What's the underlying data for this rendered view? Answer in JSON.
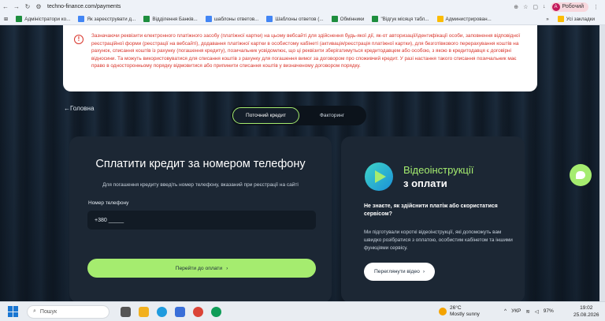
{
  "browser": {
    "url": "techno-finance.com/payments",
    "profile_label": "Робочий",
    "profile_initial": "А",
    "bookmarks": [
      {
        "label": "Адміністратори ко...",
        "color": "#1e8e3e"
      },
      {
        "label": "Як зареєструвати д...",
        "color": "#4285f4"
      },
      {
        "label": "Відділення Банків...",
        "color": "#1e8e3e"
      },
      {
        "label": "шаблоны ответов...",
        "color": "#4285f4"
      },
      {
        "label": "Шаблоны ответов (...",
        "color": "#4285f4"
      },
      {
        "label": "Обмінники",
        "color": "#1e8e3e"
      },
      {
        "label": "\"Відгук місяця табл...",
        "color": "#1e8e3e"
      },
      {
        "label": "Администрирован...",
        "color": "#fbbc04"
      }
    ],
    "all_bookmarks_label": "Усі закладки",
    "more_label": "»"
  },
  "warning": {
    "text": "Зазначаючи реквізити електронного платіжного засобу (платіжної картки) на цьому вебсайті для здійснення будь-якої дії, як-от авторизації/ідентифікації особи, заповнення відповідної реєстраційної форми (реєстрації на вебсайті), додавання платіжної картки в особистому кабінеті (активація/реєстрація платіжної картки), для безготівкового перерахування коштів на рахунок, списання коштів із рахунку (погашення кредиту), позичальник усвідомлює, що ці реквізити зберігатимуться кредитодавцем або особою, з якою в кредитодавця є договірні відносини. Та можуть використовуватися для списання коштів з рахунку для погашення вимог за договором про споживчий кредит. У разі настання такого списання позичальник має право в односторонньому порядку відмовитися або припинити списання коштів у визначеному договором порядку."
  },
  "nav": {
    "back_label": "Головна"
  },
  "tabs": [
    {
      "label": "Поточний кредит",
      "active": true
    },
    {
      "label": "Факторинг",
      "active": false
    }
  ],
  "pay_form": {
    "title": "Сплатити кредит за номером телефону",
    "hint": "Для погашення кредиту введіть номер телефону, вказаний при реєстрації на сайті",
    "phone_label": "Номер телефону",
    "phone_value": "+380 _____",
    "submit_label": "Перейти до оплати",
    "submit_arrow": "›"
  },
  "video_card": {
    "title_line1": "Відеоінструкції",
    "title_line2": "з оплати",
    "question": "Не знаєте, як здійснити платіж або скористатися сервісом?",
    "description": "Ми підготували короткі відеоінструкції, які допоможуть вам швидко розібратися з оплатою, особистим кабінетом та іншими функціями сервісу.",
    "button_label": "Переглянути відео",
    "button_arrow": "›"
  },
  "colors": {
    "accent": "#a5ec6f",
    "warning_text": "#d9352b",
    "card_bg": "#1c2734"
  },
  "taskbar": {
    "search_placeholder": "Пошук",
    "weather_temp": "26°C",
    "weather_desc": "Mostly sunny",
    "language": "УКР",
    "battery": "97%",
    "time": "19:02",
    "date": "25.08.2026"
  }
}
